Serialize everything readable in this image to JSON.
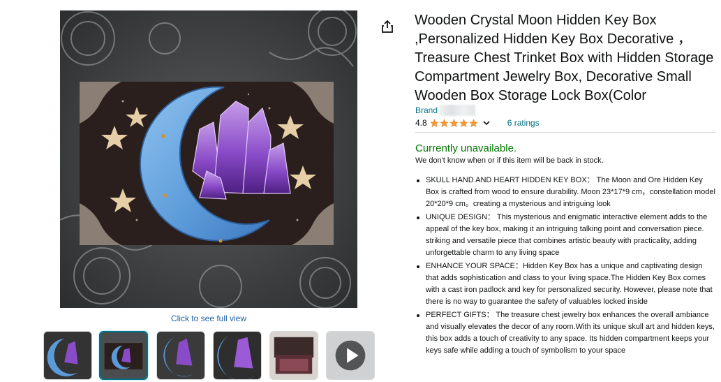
{
  "product": {
    "title": "Wooden Crystal Moon Hidden Key Box ,Personalized Hidden Key Box Decorative ，Treasure Chest Trinket Box with Hidden Storage Compartment Jewelry Box, Decorative Small Wooden Box Storage Lock Box(Color",
    "brand_label": "Brand",
    "rating_value": "4.8",
    "rating_stars": 5,
    "ratings_count_label": "6 ratings",
    "availability": "Currently unavailable.",
    "availability_note": "We don't know when or if this item will be back in stock."
  },
  "gallery": {
    "full_view_label": "Click to see full view",
    "thumbnail_count": 6,
    "selected_index": 1
  },
  "bullets": [
    "SKULL HAND AND HEART HIDDEN KEY BOX：  The Moon and Ore Hidden Key Box is crafted from wood to ensure durability. Moon 23*17*9 cm，constellation model 20*20*9 cm。creating a mysterious and intriguing look",
    "UNIQUE DESIGN：  This mysterious and enigmatic interactive element adds to the appeal of the key box, making it an intriguing talking point and conversation piece. striking and versatile piece that combines artistic beauty with practicality, adding unforgettable charm to any living space",
    "ENHANCE YOUR SPACE：Hidden Key Box has a unique and captivating design that adds sophistication and class to your living space.The Hidden Key Box comes with a cast iron padlock and key for personalized security. However, please note that there is no way to guarantee the safety of valuables locked inside",
    "PERFECT GIFTS：  The treasure chest jewelry box enhances the overall ambiance and visually elevates the decor of any room.With its unique skull art and hidden keys, this box adds a touch of creativity to any space. Its hidden compartment keeps your keys safe while adding a touch of symbolism to your space"
  ],
  "colors": {
    "link": "#007185",
    "availability_green": "#007600",
    "star_orange": "#f79b2e",
    "selected_thumb_border": "#007185"
  },
  "icons": {
    "share": "share-icon",
    "chevron": "chevron-down-icon",
    "play": "play-icon"
  }
}
